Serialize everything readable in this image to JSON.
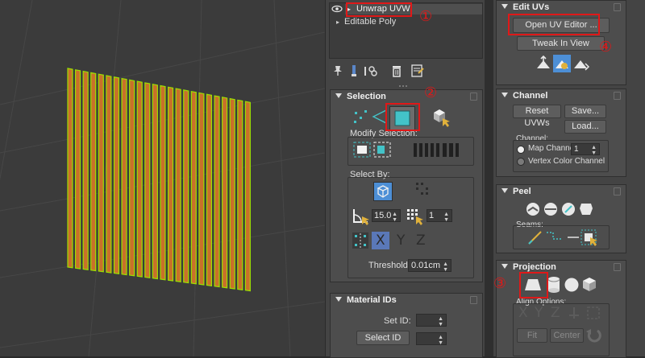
{
  "modifier_stack": {
    "items": [
      {
        "label": "Unwrap UVW",
        "expander": "▸"
      },
      {
        "label": "Editable Poly",
        "expander": "▸"
      }
    ],
    "eye_icon": "eye-icon"
  },
  "toolbar": {
    "icons": [
      "pin-icon",
      "show-end-result-icon",
      "make-unique-icon",
      "remove-modifier-icon",
      "configure-sets-icon"
    ]
  },
  "selection": {
    "title": "Selection",
    "modify_label": "Modify Selection:",
    "select_by_label": "Select By:",
    "angle_value": "15.0",
    "count_value": "1",
    "axis_letters": [
      "X",
      "Y",
      "Z"
    ],
    "threshold_label": "Threshold:",
    "threshold_value": "0.01cm"
  },
  "material_ids": {
    "title": "Material IDs",
    "set_id_label": "Set ID:",
    "select_id_label": "Select ID"
  },
  "edit_uvs": {
    "title": "Edit UVs",
    "open_editor_label": "Open UV Editor ...",
    "tweak_label": "Tweak In View"
  },
  "channel": {
    "title": "Channel",
    "reset_label": "Reset UVWs",
    "save_label": "Save...",
    "load_label": "Load...",
    "channel_label": "Channel:",
    "map_channel_label": "Map Channel:",
    "map_channel_value": "1",
    "vertex_color_label": "Vertex Color Channel"
  },
  "peel": {
    "title": "Peel",
    "seams_label": "Seams:"
  },
  "projection": {
    "title": "Projection",
    "align_label": "Align Options:",
    "align_letters": [
      "X",
      "Y",
      "Z"
    ],
    "fit_label": "Fit",
    "center_label": "Center"
  },
  "callouts": [
    "①",
    "②",
    "③",
    "④"
  ],
  "colors": {
    "highlight": "#e01818",
    "slat_orange": "#c9702a",
    "slat_edge": "#9be000",
    "accent_teal": "#43c3c8",
    "accent_blue": "#4d8fd6"
  }
}
